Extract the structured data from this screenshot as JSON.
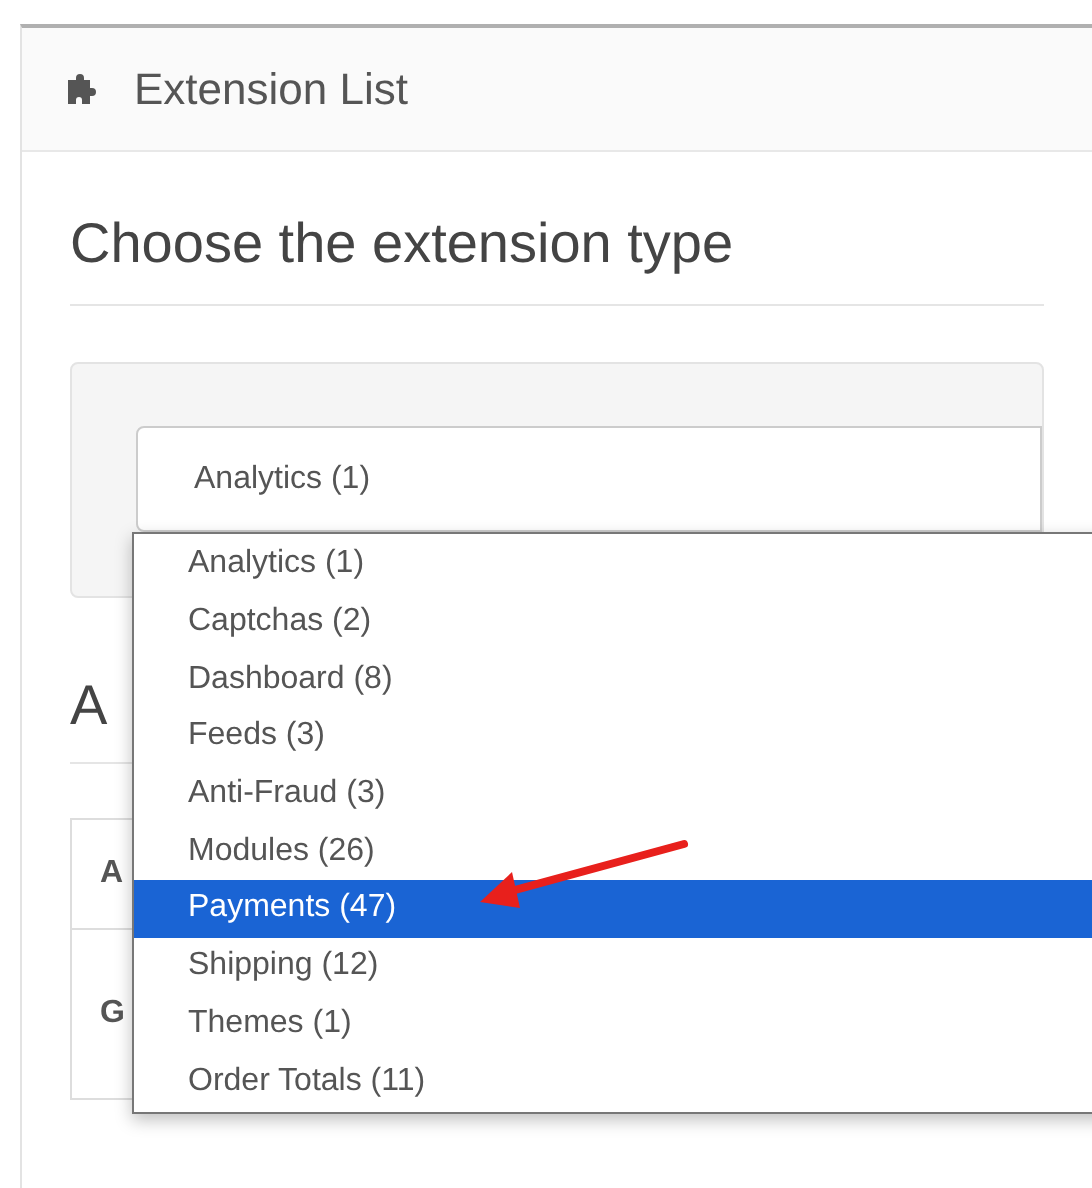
{
  "panel": {
    "title": "Extension List"
  },
  "heading": "Choose the extension type",
  "select": {
    "value": "Analytics (1)",
    "options": [
      {
        "label": "Analytics (1)",
        "highlighted": false
      },
      {
        "label": "Captchas (2)",
        "highlighted": false
      },
      {
        "label": "Dashboard (8)",
        "highlighted": false
      },
      {
        "label": "Feeds (3)",
        "highlighted": false
      },
      {
        "label": "Anti-Fraud (3)",
        "highlighted": false
      },
      {
        "label": "Modules (26)",
        "highlighted": false
      },
      {
        "label": "Payments (47)",
        "highlighted": true
      },
      {
        "label": "Shipping (12)",
        "highlighted": false
      },
      {
        "label": "Themes (1)",
        "highlighted": false
      },
      {
        "label": "Order Totals (11)",
        "highlighted": false
      }
    ]
  },
  "section_heading": "A",
  "table": {
    "columns": [
      "A"
    ],
    "rows": [
      [
        "G"
      ]
    ]
  }
}
